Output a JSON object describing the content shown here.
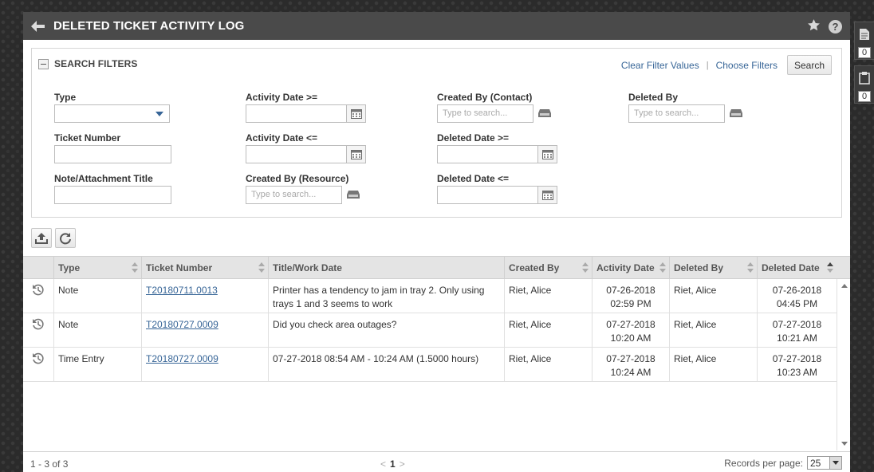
{
  "window": {
    "title": "DELETED TICKET ACTIVITY LOG"
  },
  "filters": {
    "title": "SEARCH FILTERS",
    "clear_label": "Clear Filter Values",
    "choose_label": "Choose Filters",
    "search_label": "Search",
    "type_label": "Type",
    "type_value": "",
    "ticket_number_label": "Ticket Number",
    "note_title_label": "Note/Attachment Title",
    "activity_from_label": "Activity Date >=",
    "activity_to_label": "Activity Date <=",
    "created_by_resource_label": "Created By (Resource)",
    "created_by_contact_label": "Created By (Contact)",
    "deleted_from_label": "Deleted Date >=",
    "deleted_to_label": "Deleted Date <=",
    "deleted_by_label": "Deleted By",
    "search_placeholder": "Type to search..."
  },
  "grid": {
    "columns": [
      "Type",
      "Ticket Number",
      "Title/Work Date",
      "Created By",
      "Activity Date",
      "Deleted By",
      "Deleted Date"
    ],
    "rows": [
      {
        "type": "Note",
        "ticket": "T20180711.0013",
        "title": "Printer has a tendency to jam in tray 2. Only using trays 1 and 3 seems to work",
        "created_by": "Riet, Alice",
        "activity_date": "07-26-2018 02:59 PM",
        "deleted_by": "Riet, Alice",
        "deleted_date": "07-26-2018 04:45 PM"
      },
      {
        "type": "Note",
        "ticket": "T20180727.0009",
        "title": "Did you check area outages?",
        "created_by": "Riet, Alice",
        "activity_date": "07-27-2018 10:20 AM",
        "deleted_by": "Riet, Alice",
        "deleted_date": "07-27-2018 10:21 AM"
      },
      {
        "type": "Time Entry",
        "ticket": "T20180727.0009",
        "title": "07-27-2018 08:54 AM - 10:24 AM (1.5000 hours)",
        "created_by": "Riet, Alice",
        "activity_date": "07-27-2018 10:24 AM",
        "deleted_by": "Riet, Alice",
        "deleted_date": "07-27-2018 10:23 AM"
      }
    ]
  },
  "footer": {
    "count": "1 - 3 of 3",
    "prev": "<",
    "page": "1",
    "next": ">",
    "rpp_label": "Records per page:",
    "rpp_value": "25"
  },
  "side": {
    "notes_count": "0",
    "clipboard_count": "0"
  },
  "colors": {
    "titlebar": "#4a4a4a",
    "link": "#376597",
    "header": "#e4e4e4"
  }
}
